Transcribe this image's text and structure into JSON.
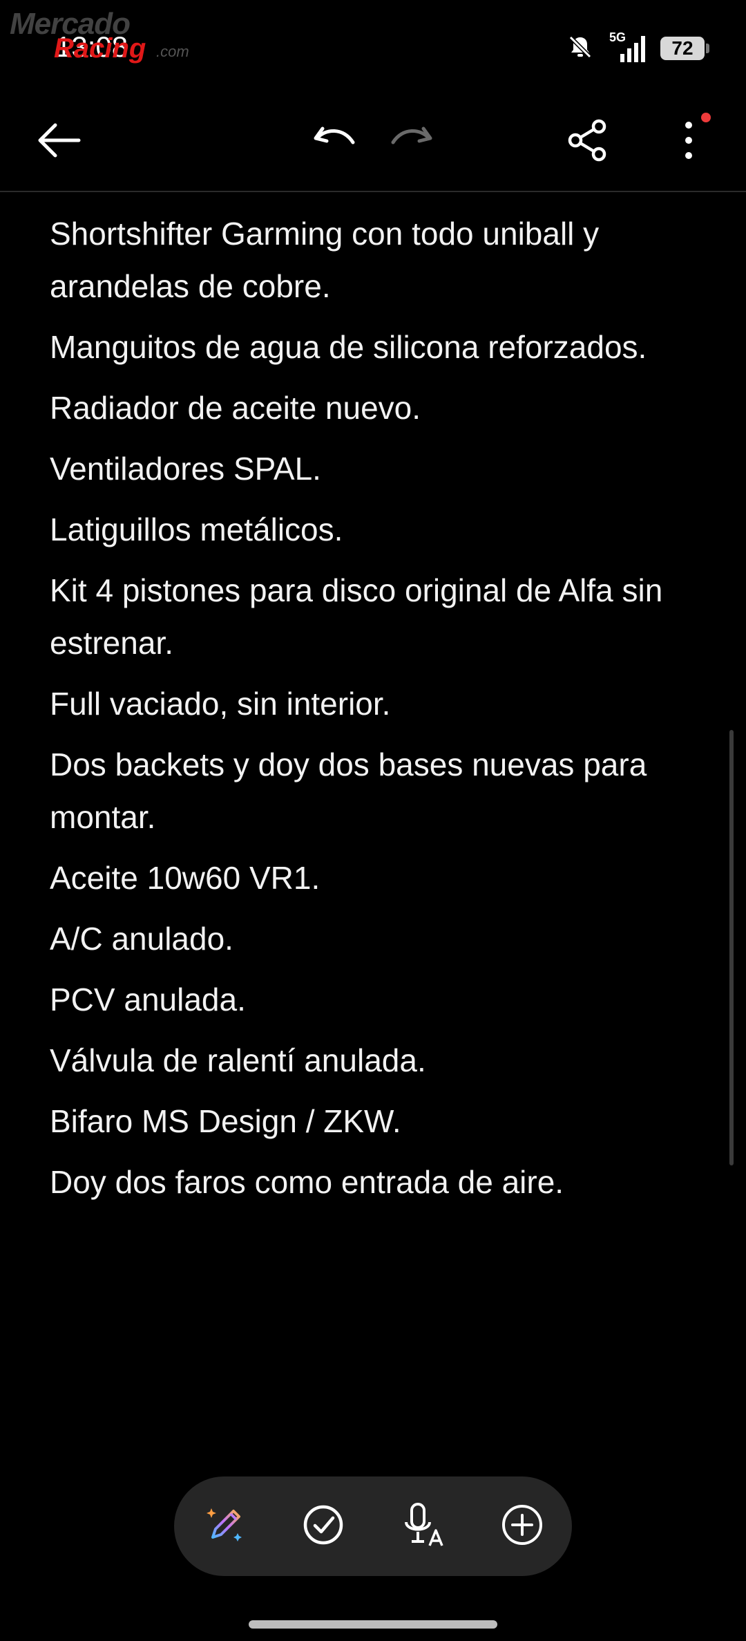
{
  "status_bar": {
    "time": "13:08",
    "network": "5G",
    "battery": "72"
  },
  "watermark": {
    "line1": "Mercado",
    "line2": "Racing",
    "suffix": ".com"
  },
  "toolbar": {
    "back_icon": "arrow-left-icon",
    "undo_icon": "undo-icon",
    "redo_icon": "redo-icon",
    "share_icon": "share-icon",
    "more_icon": "more-vertical-icon"
  },
  "note": {
    "lines": [
      "Shortshifter Garming con todo uniball y arandelas de cobre.",
      "Manguitos de agua de silicona reforzados.",
      "Radiador de aceite nuevo.",
      "Ventiladores SPAL.",
      "Latiguillos metálicos.",
      "Kit 4 pistones para disco original de Alfa sin estrenar.",
      "Full vaciado, sin interior.",
      "Dos backets y doy dos bases nuevas para montar.",
      "Aceite 10w60 VR1.",
      "A/C anulado.",
      "PCV anulada.",
      "Válvula de ralentí anulada.",
      "Bifaro MS Design / ZKW.",
      "Doy dos faros como entrada de aire."
    ]
  },
  "bottom_toolbar": {
    "icons": [
      "ai-pen-icon",
      "checkbox-icon",
      "voice-transcribe-icon",
      "add-icon"
    ]
  },
  "colors": {
    "background": "#000000",
    "text": "#f2f2f2",
    "bar": "#262626",
    "badge": "#ee3b3b"
  }
}
